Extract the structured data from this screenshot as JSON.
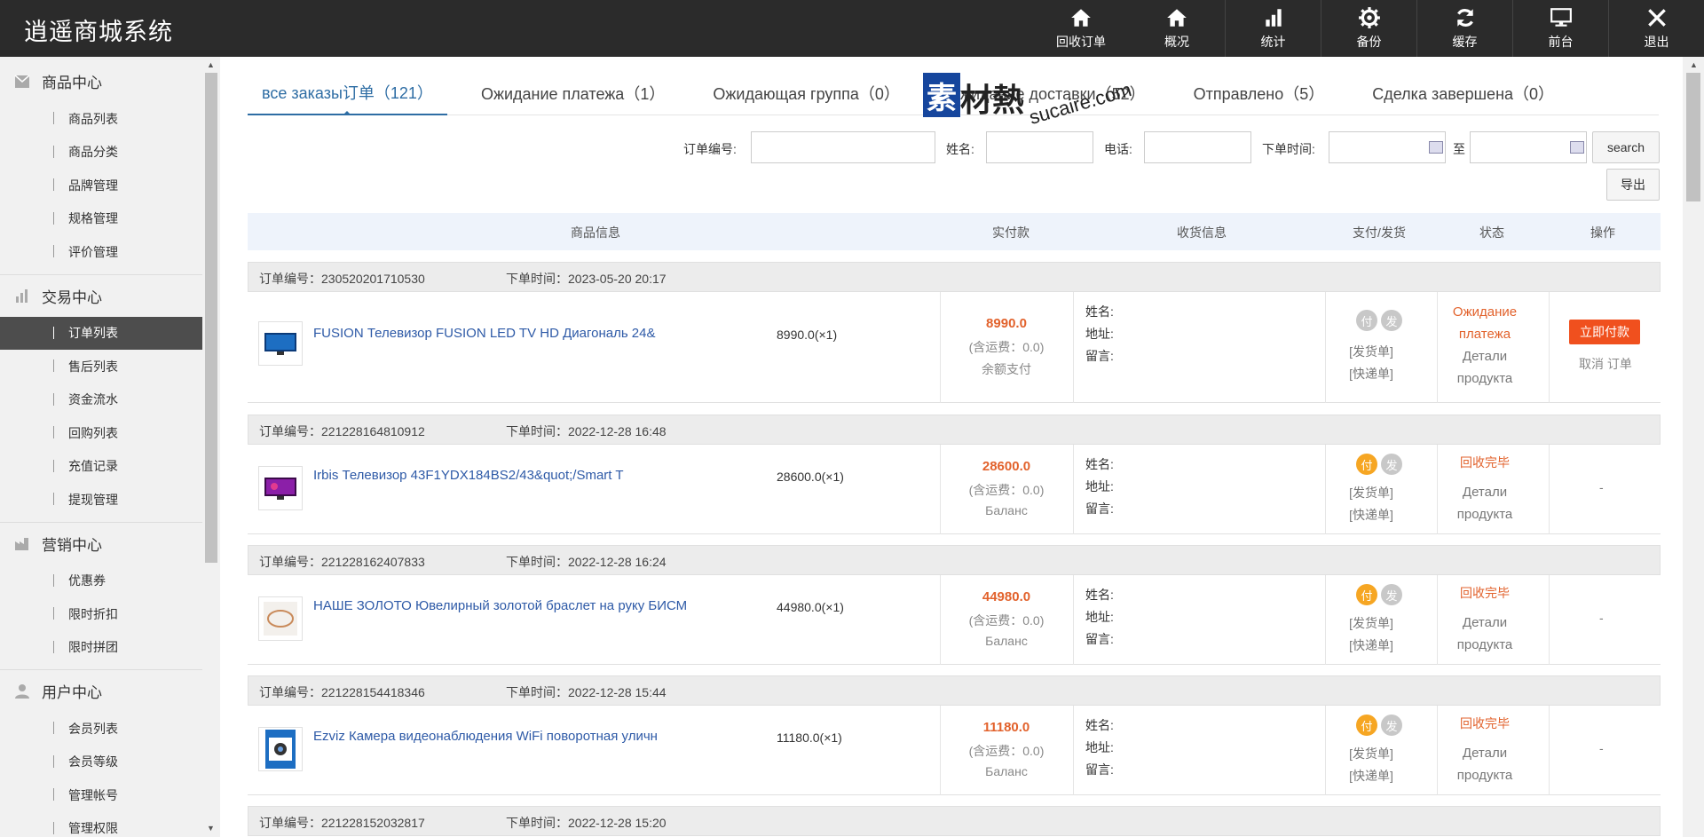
{
  "app": {
    "title": "逍遥商城系统"
  },
  "topnav": [
    {
      "label": "回收订单",
      "icon": "home-icon"
    },
    {
      "label": "概况",
      "icon": "home-icon"
    },
    {
      "label": "统计",
      "icon": "bar-chart-icon"
    },
    {
      "label": "备份",
      "icon": "gear-icon"
    },
    {
      "label": "缓存",
      "icon": "refresh-icon"
    },
    {
      "label": "前台",
      "icon": "monitor-icon"
    },
    {
      "label": "退出",
      "icon": "close-icon"
    }
  ],
  "sidebar": {
    "groups": [
      {
        "title": "商品中心",
        "icon": "box-icon",
        "items": [
          "商品列表",
          "商品分类",
          "品牌管理",
          "规格管理",
          "评价管理"
        ]
      },
      {
        "title": "交易中心",
        "icon": "bar-chart-icon",
        "items": [
          "订单列表",
          "售后列表",
          "资金流水",
          "回购列表",
          "充值记录",
          "提现管理"
        ]
      },
      {
        "title": "营销中心",
        "icon": "factory-icon",
        "items": [
          "优惠券",
          "限时折扣",
          "限时拼团"
        ]
      },
      {
        "title": "用户中心",
        "icon": "user-icon",
        "items": [
          "会员列表",
          "会员等级",
          "管理帐号",
          "管理权限"
        ]
      }
    ],
    "active_item": "订单列表"
  },
  "tabs": [
    {
      "label": "все заказы订单（121）",
      "active": true
    },
    {
      "label": "Ожидание платежа（1）",
      "active": false
    },
    {
      "label": "Ожидающая группа（0）",
      "active": false
    },
    {
      "label": "Ожидание доставки（52）",
      "active": false
    },
    {
      "label": "Отправлено（5）",
      "active": false
    },
    {
      "label": "Сделка завершена（0）",
      "active": false
    }
  ],
  "watermark": {
    "main": "素材熱",
    "sub": "sucaire.com"
  },
  "filters": {
    "order_no_label": "订单编号:",
    "name_label": "姓名:",
    "phone_label": "电话:",
    "time_label": "下单时间:",
    "to_label": "至",
    "search_btn": "search",
    "export_btn": "导出"
  },
  "table_headers": [
    "商品信息",
    "实付款",
    "收货信息",
    "支付/发货",
    "状态",
    "操作"
  ],
  "orders": [
    {
      "order_no_label": "订单编号：230520201710530",
      "time_label": "下单时间：2023-05-20 20:17",
      "product": "FUSION Телевизор FUSION LED TV HD Диагональ 24&",
      "price": "8990.0(×1)",
      "paid": "8990.0",
      "shipping_fee": "(含运费：0.0)",
      "pay_method": "余额支付",
      "recv_name": "姓名:",
      "recv_addr": "地址:",
      "recv_msg": "留言:",
      "pay_badge": "付",
      "ship_badge": "发",
      "paid_state": "gray",
      "ship_link": "[发货单]",
      "express_link": "[快递单]",
      "status": "Ожидание платежа",
      "status_line1": "Ожидание",
      "status_line2": "платежа",
      "detail1": "Детали",
      "detail2": "продукта",
      "action": "立即付款",
      "cancel": "取消 订单"
    },
    {
      "order_no_label": "订单编号：221228164810912",
      "time_label": "下单时间：2022-12-28 16:48",
      "product": "Irbis Телевизор 43F1YDX184BS2/43&quot;/Smart T",
      "price": "28600.0(×1)",
      "paid": "28600.0",
      "shipping_fee": "(含运费：0.0)",
      "pay_method": "Баланс",
      "recv_name": "姓名:",
      "recv_addr": "地址:",
      "recv_msg": "留言:",
      "pay_badge": "付",
      "ship_badge": "发",
      "paid_state": "orange",
      "ship_link": "[发货单]",
      "express_link": "[快递单]",
      "status": "回收完毕",
      "detail1": "Детали",
      "detail2": "продукта",
      "action": "-"
    },
    {
      "order_no_label": "订单编号：221228162407833",
      "time_label": "下单时间：2022-12-28 16:24",
      "product": "НАШЕ ЗОЛОТО Ювелирный золотой браслет на руку БИСМ",
      "price": "44980.0(×1)",
      "paid": "44980.0",
      "shipping_fee": "(含运费：0.0)",
      "pay_method": "Баланс",
      "recv_name": "姓名:",
      "recv_addr": "地址:",
      "recv_msg": "留言:",
      "pay_badge": "付",
      "ship_badge": "发",
      "paid_state": "orange",
      "ship_link": "[发货单]",
      "express_link": "[快递单]",
      "status": "回收完毕",
      "detail1": "Детали",
      "detail2": "продукта",
      "action": "-"
    },
    {
      "order_no_label": "订单编号：221228154418346",
      "time_label": "下单时间：2022-12-28 15:44",
      "product": "Ezviz Камера видеонаблюдения WiFi поворотная уличн",
      "price": "11180.0(×1)",
      "paid": "11180.0",
      "shipping_fee": "(含运费：0.0)",
      "pay_method": "Баланс",
      "recv_name": "姓名:",
      "recv_addr": "地址:",
      "recv_msg": "留言:",
      "pay_badge": "付",
      "ship_badge": "发",
      "paid_state": "orange",
      "ship_link": "[发货单]",
      "express_link": "[快递单]",
      "status": "回收完毕",
      "detail1": "Детали",
      "detail2": "продукта",
      "action": "-"
    },
    {
      "order_no_label": "订单编号：221228152032817",
      "time_label": "下单时间：2022-12-28 15:20"
    }
  ],
  "colors": {
    "topbar": "#2b2b2b",
    "accent": "#2e6da4",
    "price": "#e2622c",
    "pay_button": "#f0501e",
    "badge_paid": "#f6a623"
  }
}
